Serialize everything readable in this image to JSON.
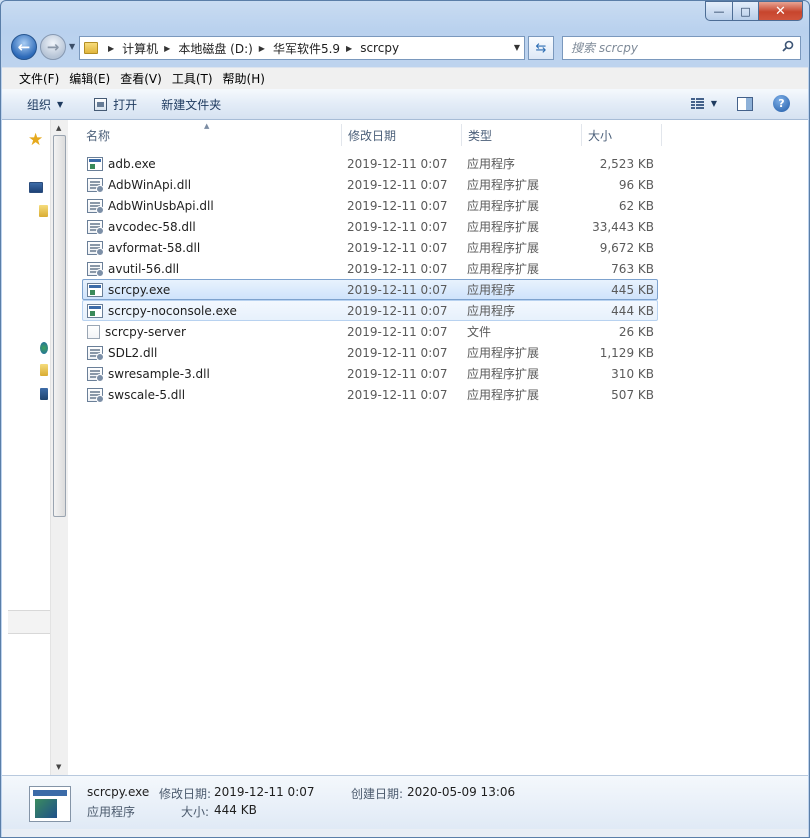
{
  "window": {
    "minimize": "—",
    "maximize": "□",
    "close": "✕"
  },
  "nav": {
    "back": "←",
    "forward": "→",
    "breadcrumbs": [
      "计算机",
      "本地磁盘 (D:)",
      "华军软件5.9",
      "scrcpy"
    ],
    "search_placeholder": "搜索 scrcpy"
  },
  "menubar": [
    "文件(F)",
    "编辑(E)",
    "查看(V)",
    "工具(T)",
    "帮助(H)"
  ],
  "toolbar": {
    "organize": "组织",
    "open": "打开",
    "new_folder": "新建文件夹",
    "help": "?"
  },
  "columns": {
    "name": "名称",
    "date": "修改日期",
    "type": "类型",
    "size": "大小"
  },
  "files": [
    {
      "name": "adb.exe",
      "date": "2019-12-11 0:07",
      "type": "应用程序",
      "size": "2,523 KB",
      "icon": "exe-icon"
    },
    {
      "name": "AdbWinApi.dll",
      "date": "2019-12-11 0:07",
      "type": "应用程序扩展",
      "size": "96 KB",
      "icon": "dll-icon"
    },
    {
      "name": "AdbWinUsbApi.dll",
      "date": "2019-12-11 0:07",
      "type": "应用程序扩展",
      "size": "62 KB",
      "icon": "dll-icon"
    },
    {
      "name": "avcodec-58.dll",
      "date": "2019-12-11 0:07",
      "type": "应用程序扩展",
      "size": "33,443 KB",
      "icon": "dll-icon"
    },
    {
      "name": "avformat-58.dll",
      "date": "2019-12-11 0:07",
      "type": "应用程序扩展",
      "size": "9,672 KB",
      "icon": "dll-icon"
    },
    {
      "name": "avutil-56.dll",
      "date": "2019-12-11 0:07",
      "type": "应用程序扩展",
      "size": "763 KB",
      "icon": "dll-icon"
    },
    {
      "name": "scrcpy.exe",
      "date": "2019-12-11 0:07",
      "type": "应用程序",
      "size": "445 KB",
      "icon": "exe-icon",
      "state": "selected"
    },
    {
      "name": "scrcpy-noconsole.exe",
      "date": "2019-12-11 0:07",
      "type": "应用程序",
      "size": "444 KB",
      "icon": "exe-icon",
      "state": "hover"
    },
    {
      "name": "scrcpy-server",
      "date": "2019-12-11 0:07",
      "type": "文件",
      "size": "26 KB",
      "icon": "file-icon"
    },
    {
      "name": "SDL2.dll",
      "date": "2019-12-11 0:07",
      "type": "应用程序扩展",
      "size": "1,129 KB",
      "icon": "dll-icon"
    },
    {
      "name": "swresample-3.dll",
      "date": "2019-12-11 0:07",
      "type": "应用程序扩展",
      "size": "310 KB",
      "icon": "dll-icon"
    },
    {
      "name": "swscale-5.dll",
      "date": "2019-12-11 0:07",
      "type": "应用程序扩展",
      "size": "507 KB",
      "icon": "dll-icon"
    }
  ],
  "details": {
    "filename": "scrcpy.exe",
    "modified_label": "修改日期:",
    "modified_value": "2019-12-11 0:07",
    "created_label": "创建日期:",
    "created_value": "2020-05-09 13:06",
    "type": "应用程序",
    "size_label": "大小:",
    "size_value": "444 KB"
  },
  "colors": {
    "selection_border": "#7da2ce",
    "frame_blue": "#b9d1ee"
  }
}
